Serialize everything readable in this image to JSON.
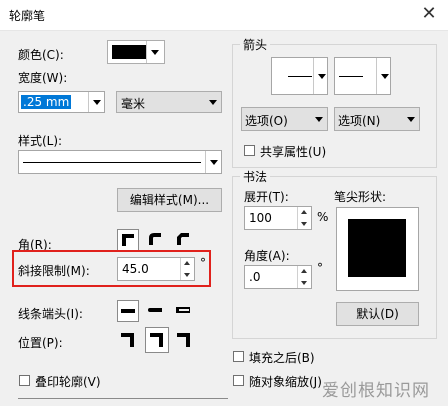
{
  "window": {
    "title": "轮廓笔",
    "close_glyph": "✕"
  },
  "left": {
    "color_label": "颜色(C):",
    "color_value": "#000000",
    "width_label": "宽度(W):",
    "width_value": ".25 mm",
    "unit_value": "毫米",
    "style_label": "样式(L):",
    "edit_style_button": "编辑样式(M)...",
    "corner_label": "角(R):",
    "miter_label": "斜接限制(M):",
    "miter_value": "45.0",
    "miter_unit": "°",
    "cap_label": "线条端头(I):",
    "position_label": "位置(P):",
    "overprint_label": "叠印轮廓(V)"
  },
  "arrows": {
    "group_label": "箭头",
    "options_left": "选项(O)",
    "options_right": "选项(N)",
    "share_attr_label": "共享属性(U)"
  },
  "calligraphy": {
    "group_label": "书法",
    "stretch_label": "展开(T):",
    "stretch_value": "100",
    "stretch_unit": "%",
    "angle_label": "角度(A):",
    "angle_value": ".0",
    "angle_unit": "°",
    "nib_label": "笔尖形状:",
    "default_button": "默认(D)"
  },
  "bottom": {
    "fill_behind_label": "填充之后(B)",
    "scale_with_label": "随对象缩放(J)"
  },
  "watermark": {
    "text": "爱创根知识网"
  }
}
